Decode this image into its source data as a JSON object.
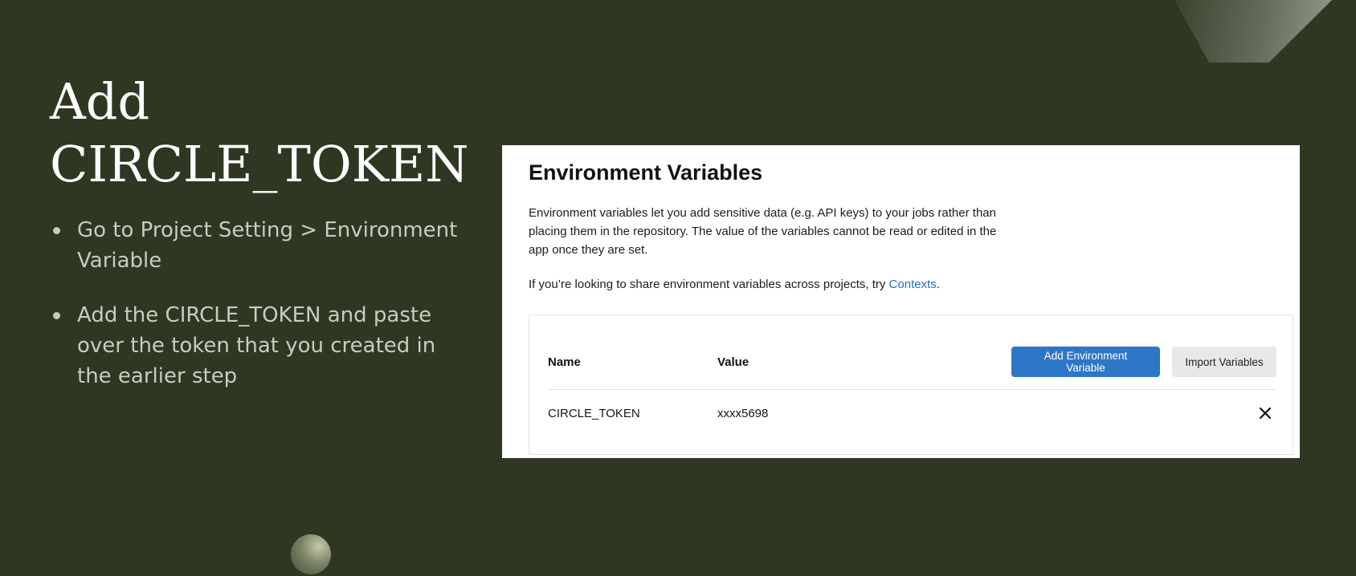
{
  "slide": {
    "title_line1": "Add",
    "title_line2": "CIRCLE_TOKEN",
    "bullets": [
      "Go to Project Setting > Environment Variable",
      "Add the CIRCLE_TOKEN  and paste over the token that you created in the earlier step"
    ]
  },
  "env_panel": {
    "heading": "Environment Variables",
    "description": "Environment variables let you add sensitive data (e.g. API keys) to your jobs rather than placing them in the repository. The value of the variables cannot be read or edited in the app once they are set.",
    "share_prefix": "If you’re looking to share environment variables across projects, try ",
    "share_link": "Contexts",
    "share_suffix": ".",
    "columns": {
      "name": "Name",
      "value": "Value"
    },
    "add_button": "Add Environment Variable",
    "import_button": "Import Variables",
    "rows": [
      {
        "name": "CIRCLE_TOKEN",
        "value": "xxxx5698",
        "delete_icon": "close-icon"
      }
    ]
  },
  "colors": {
    "background": "#2f3722",
    "primary_button": "#2e76c6",
    "link": "#1f6fc6"
  }
}
